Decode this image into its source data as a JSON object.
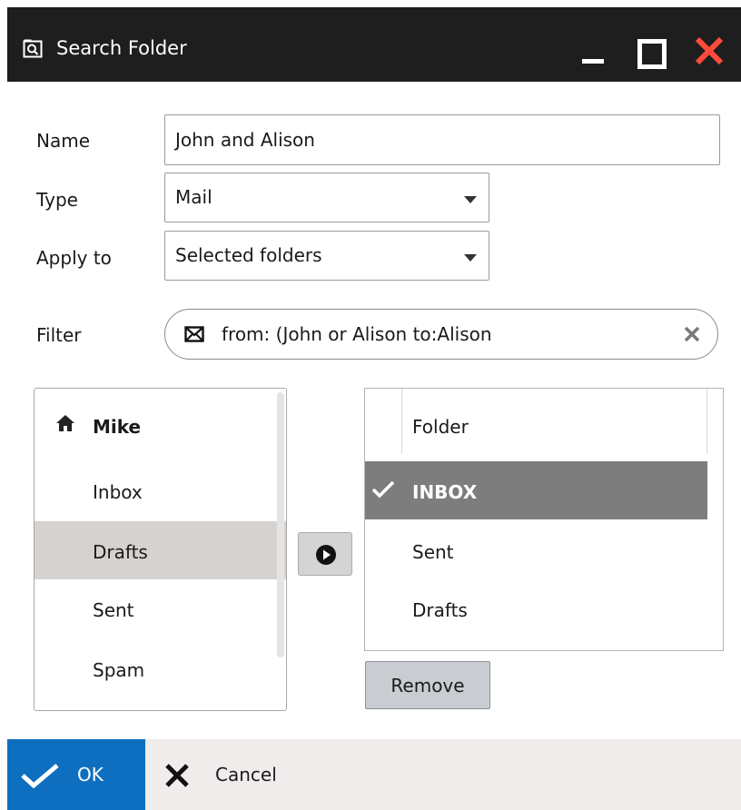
{
  "window": {
    "title": "Search Folder"
  },
  "form": {
    "name_label": "Name",
    "name_value": "John and Alison",
    "type_label": "Type",
    "type_value": "Mail",
    "apply_label": "Apply to",
    "apply_value": "Selected folders",
    "filter_label": "Filter",
    "filter_value": "from: (John or Alison to:Alison"
  },
  "tree": {
    "root": "Mike",
    "items": [
      "Inbox",
      "Drafts",
      "Sent",
      "Spam"
    ],
    "selected": "Drafts"
  },
  "list": {
    "header": "Folder",
    "rows": [
      "INBOX",
      "Sent",
      "Drafts"
    ],
    "selected": "INBOX"
  },
  "buttons": {
    "remove": "Remove",
    "ok": "OK",
    "cancel": "Cancel"
  },
  "colors": {
    "titlebar": "#1e1e1e",
    "close": "#ff4a3d",
    "ok": "#0e6fc0",
    "tree_selected": "#d6d2d0",
    "list_selected": "#7d7d7d"
  }
}
